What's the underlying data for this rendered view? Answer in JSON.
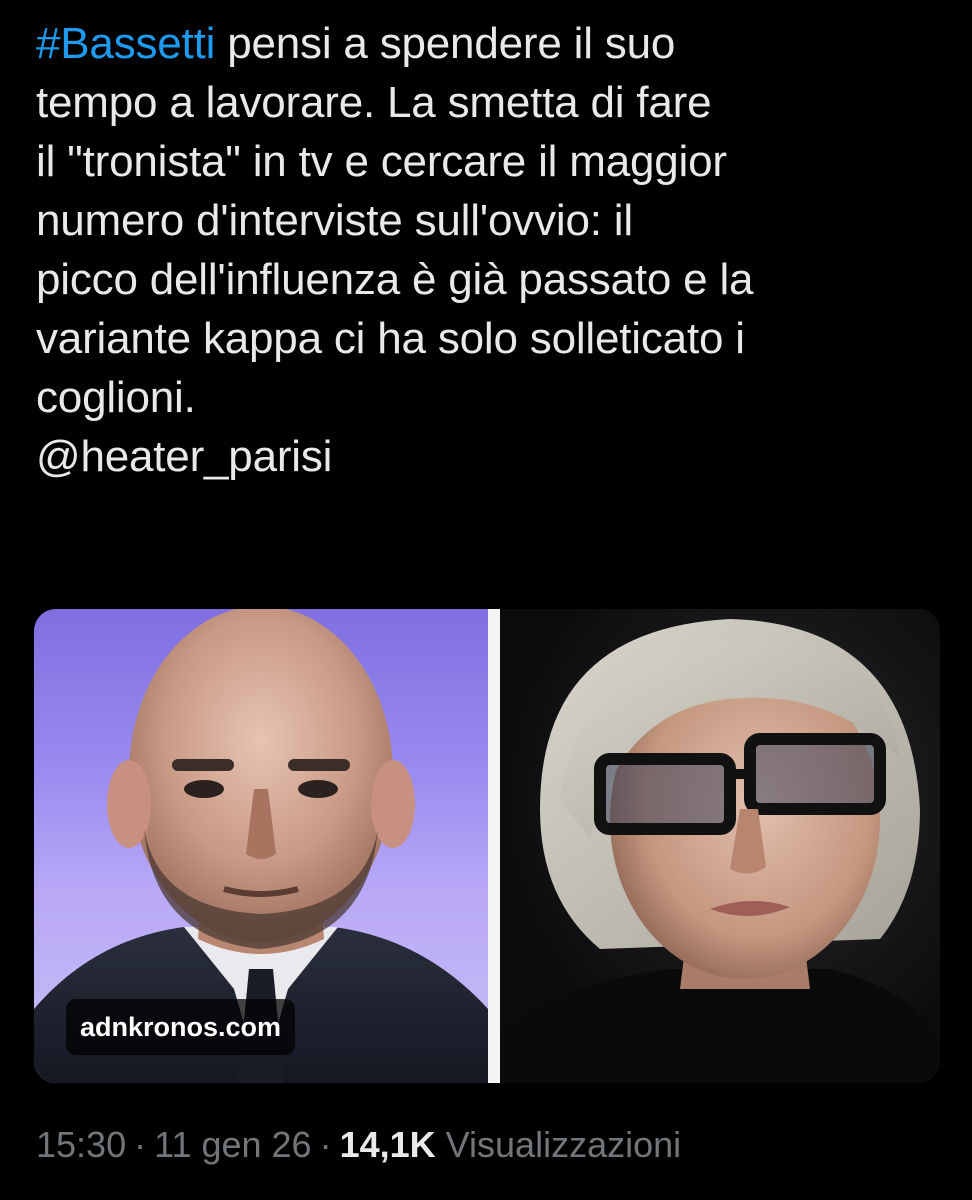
{
  "tweet": {
    "lines": [
      {
        "hashtag": "#Bassetti",
        "text": " pensi a spendere il suo"
      },
      {
        "text": "tempo a lavorare. La smetta di fare"
      },
      {
        "text": "il \"tronista\" in tv e cercare il maggior"
      },
      {
        "text": "numero d'interviste sull'ovvio: il"
      },
      {
        "text": "picco dell'influenza è già passato e la"
      },
      {
        "text": "variante kappa ci ha solo solleticato i"
      },
      {
        "text": "coglioni."
      }
    ],
    "mention": "@heater_parisi"
  },
  "media": {
    "left_image": "photo-man-bald-beard",
    "right_image": "photo-woman-glasses",
    "watermark": "adnkronos.com"
  },
  "meta": {
    "time": "15:30",
    "separator": "·",
    "date": "11 gen 26",
    "views_count": "14,1K",
    "views_label": "Visualizzazioni"
  },
  "colors": {
    "background": "#000000",
    "text": "#e7e9ea",
    "hashtag": "#1d9bf0",
    "muted": "#71767b"
  }
}
